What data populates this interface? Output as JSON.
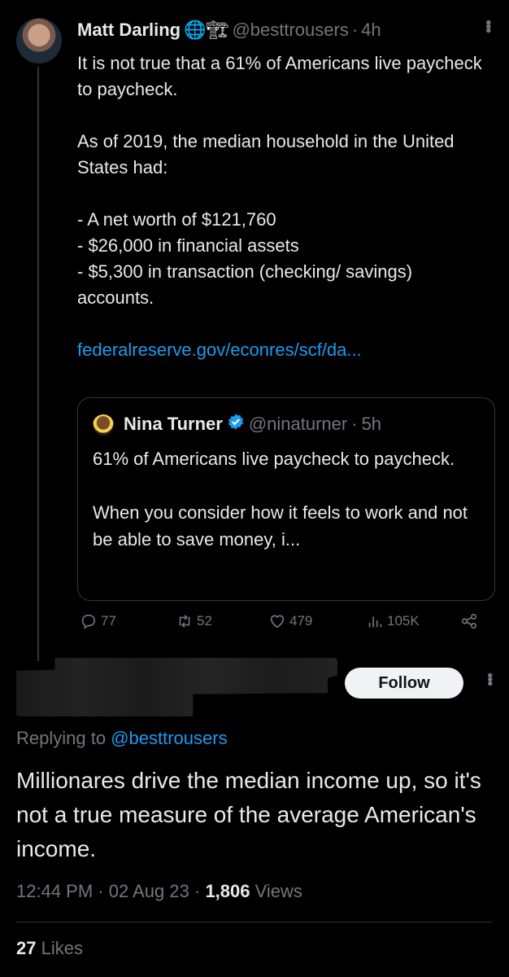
{
  "tweet": {
    "author_name": "Matt Darling",
    "author_emoji": "🌐🏗",
    "handle": "@besttrousers",
    "time": "4h",
    "separator": "·",
    "paragraph1": "It is not true that a 61% of Americans live paycheck to paycheck.",
    "paragraph2": "As of 2019, the median household in the United States had:",
    "list": [
      "- A net worth of $121,760",
      "- $26,000 in financial assets",
      "- $5,300 in transaction (checking/ savings) accounts."
    ],
    "link": "federalreserve.gov/econres/scf/da...",
    "quote": {
      "author_name": "Nina Turner",
      "handle": "@ninaturner",
      "time": "5h",
      "paragraph1": "61% of Americans live paycheck to paycheck.",
      "paragraph2": "When you consider how it feels to work and not be able to save money, i..."
    },
    "actions": {
      "replies": "77",
      "retweets": "52",
      "likes": "479",
      "views": "105K"
    }
  },
  "reply": {
    "follow_label": "Follow",
    "replying_prefix": "Replying to",
    "replying_handle": "@besttrousers",
    "text": "Millionares drive the median income up, so it's not a true measure of the average American's income.",
    "time": "12:44 PM",
    "date": "02 Aug 23",
    "views_count": "1,806",
    "views_label": "Views",
    "likes_count": "27",
    "likes_label": "Likes"
  },
  "colors": {
    "background": "#000000",
    "text": "#e7e9ea",
    "muted": "#71767b",
    "link": "#1d9bf0",
    "verified": "#1d9bf0"
  }
}
